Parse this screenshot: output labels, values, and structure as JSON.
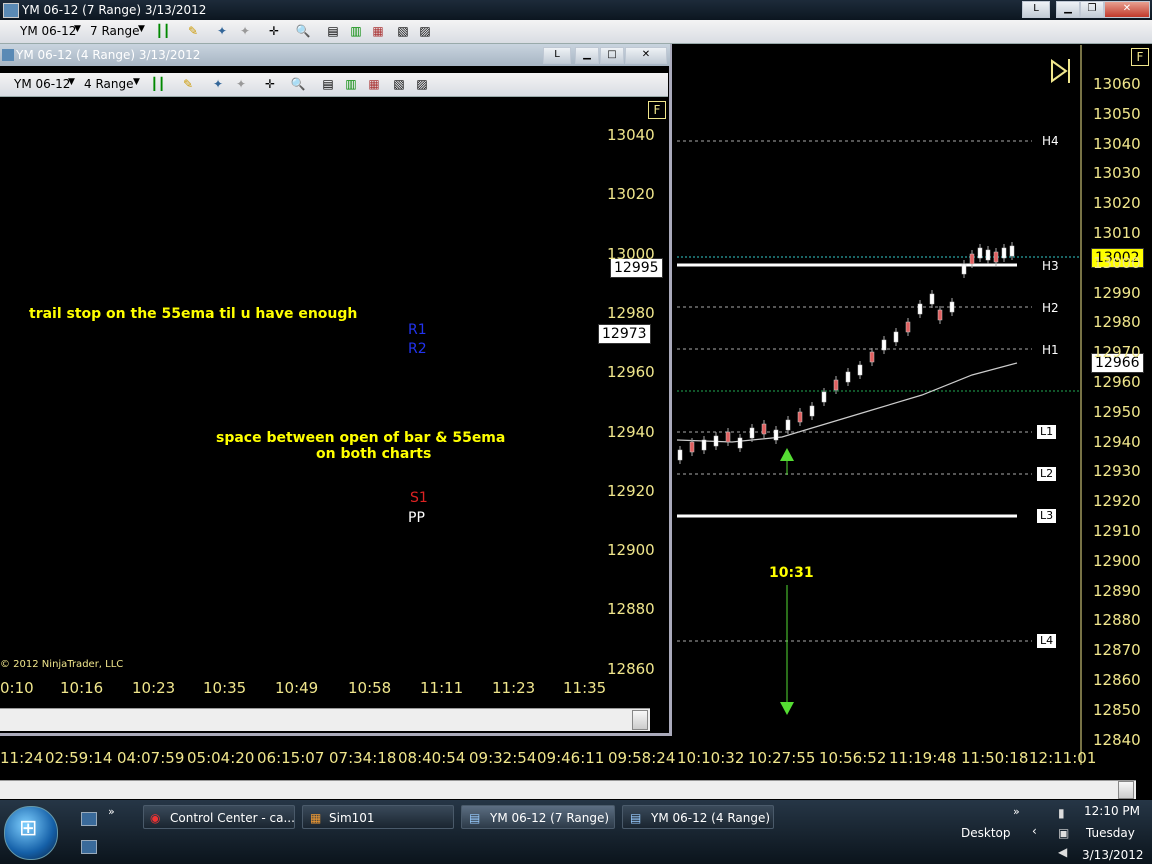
{
  "back_window": {
    "title": "YM 06-12 (7 Range)  3/13/2012",
    "instrument": "YM 06-12",
    "range": "7 Range",
    "min_label": "L",
    "f_label": "F",
    "price_axis": [
      "13060",
      "13050",
      "13040",
      "13030",
      "13020",
      "13010",
      "13000",
      "12990",
      "12980",
      "12970",
      "12960",
      "12950",
      "12940",
      "12930",
      "12920",
      "12910",
      "12900",
      "12890",
      "12880",
      "12870",
      "12860",
      "12850",
      "12840"
    ],
    "price_tags": [
      "13002",
      "12966"
    ],
    "pivots": [
      "H4",
      "H3",
      "H2",
      "H1",
      "L1",
      "L2",
      "L3",
      "L4"
    ],
    "time_axis": [
      "11:24",
      "02:59:14",
      "04:07:59",
      "05:04:20",
      "06:15:07",
      "07:34:18",
      "08:40:54",
      "09:32:54",
      "09:46:11",
      "09:58:24",
      "10:10:32",
      "10:27:55",
      "10:56:52",
      "11:19:48",
      "11:50:18",
      "12:11:01"
    ],
    "time_note": "10:31"
  },
  "front_window": {
    "title": "YM 06-12 (4 Range)  3/13/2012",
    "instrument": "YM 06-12",
    "range": "4 Range",
    "min_label": "L",
    "f_label": "F",
    "price_axis": [
      "13040",
      "13020",
      "13000",
      "12980",
      "12960",
      "12940",
      "12920",
      "12900",
      "12880",
      "12860"
    ],
    "price_tags": [
      "12995",
      "12973"
    ],
    "levels": [
      "R1",
      "R2",
      "S1",
      "PP"
    ],
    "time_axis": [
      "0:10",
      "10:16",
      "10:23",
      "10:35",
      "10:49",
      "10:58",
      "11:11",
      "11:23",
      "11:35"
    ],
    "copyright": "© 2012 NinjaTrader, LLC",
    "note1": "trail stop on the 55ema til u have enough",
    "note2a": "space between open of bar & 55ema",
    "note2b": "on both charts"
  },
  "taskbar": {
    "buttons": [
      "Control Center - ca...",
      "Sim101",
      "YM 06-12 (7 Range) ...",
      "YM 06-12 (4 Range) ..."
    ],
    "desktop": "Desktop",
    "time": "12:10 PM",
    "day": "Tuesday",
    "date": "3/13/2012"
  },
  "colors": {
    "axis": "#f0e68c",
    "note": "#ffff00",
    "arrow": "#55dd33",
    "r_line": "#2233ee",
    "s1": "#dd2222"
  }
}
